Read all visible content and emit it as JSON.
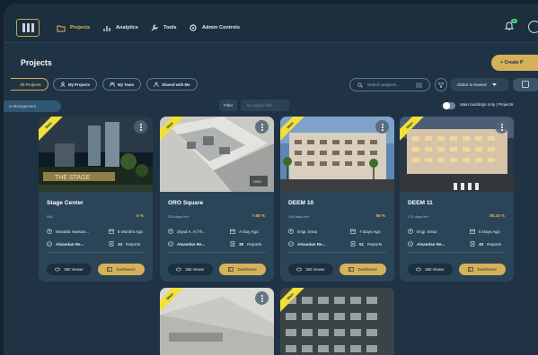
{
  "nav": {
    "items": [
      {
        "label": "Projects",
        "active": true,
        "icon": "folder-icon"
      },
      {
        "label": "Analytics",
        "icon": "bar-chart-icon"
      },
      {
        "label": "Tools",
        "icon": "wrench-icon"
      },
      {
        "label": "Admin Controls",
        "icon": "gear-icon"
      }
    ],
    "notification_count": "9+"
  },
  "header": {
    "title": "Projects",
    "create_label": "+ Create P"
  },
  "filters": {
    "chips": [
      "All Projects",
      "My Projects",
      "My Team",
      "Shared with Me"
    ],
    "search_placeholder": "Search projects...",
    "sort_label": "Oldest to Newest",
    "management_label": "rs Management",
    "filter_label": "Filter",
    "filter_placeholder": "No applied filter",
    "toggle_label": "Main buildings only",
    "toggle_suffix": "Projects"
  },
  "colors": {
    "accent": "#d7b15a",
    "ribbon": "#f2df38",
    "card_bg": "#2b4558",
    "page_bg": "#1f3344"
  },
  "cards": [
    {
      "title": "Stage Center",
      "days": "N/A",
      "progress": "0 %",
      "owner": "Mustafa Hassan...",
      "updated": "5 Months Ago",
      "company": "Alsaedan Re...",
      "reports": "34",
      "reports_label": "Reports",
      "ribbon": "Main",
      "viewer": "360 Viewer",
      "dashboard": "Dashboard"
    },
    {
      "title": "ORO Square",
      "days": "326 days left",
      "progress": "7.68 %",
      "owner": "Ziyad A. Al Th...",
      "updated": "A Day Ago",
      "company": "Alsaedan Re...",
      "reports": "38",
      "reports_label": "Reports",
      "ribbon": "Main",
      "viewer": "360 Viewer",
      "dashboard": "Dashboard"
    },
    {
      "title": "DEEM 10",
      "days": "149 days left",
      "progress": "86 %",
      "owner": "Engr. Essa",
      "updated": "7 Days Ago",
      "company": "Alsaedan Re...",
      "reports": "51",
      "reports_label": "Reports",
      "ribbon": "Main",
      "viewer": "360 Viewer",
      "dashboard": "Dashboard"
    },
    {
      "title": "DEEM 11",
      "days": "171 days left",
      "progress": "85.15 %",
      "owner": "Engr. Essa",
      "updated": "5 Days Ago",
      "company": "Alsaedan Re...",
      "reports": "49",
      "reports_label": "Reports",
      "ribbon": "Main",
      "viewer": "360 Viewer",
      "dashboard": "Dashboard"
    }
  ],
  "lower_cards": [
    {
      "ribbon": "Main"
    },
    {
      "ribbon": "Main"
    }
  ]
}
